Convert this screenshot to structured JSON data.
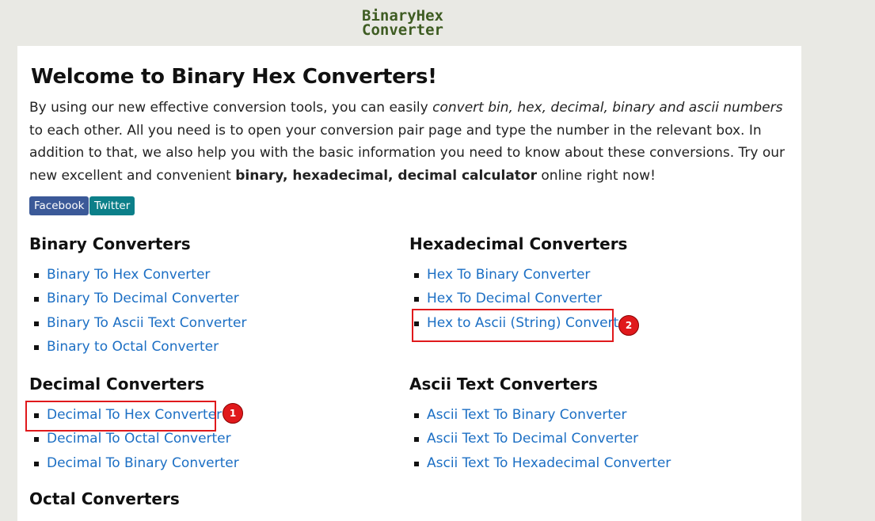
{
  "header": {
    "logo_line1": "BinaryHex",
    "logo_line2": "Converter"
  },
  "main": {
    "title": "Welcome to Binary Hex Converters!",
    "intro": {
      "part1": "By using our new effective conversion tools, you can easily ",
      "italic": "convert bin, hex, decimal, binary and ascii numbers",
      "part2": " to each other. All you need is to open your conversion pair page and type the number in the relevant box. In addition to that, we also help you with the basic information you need to know about these conversions. Try our new excellent and convenient ",
      "bold": "binary, hexadecimal, decimal calculator",
      "part3": " online right now!"
    },
    "share": {
      "facebook": "Facebook",
      "twitter": "Twitter"
    },
    "sections": {
      "binary": {
        "title": "Binary Converters",
        "links": [
          "Binary To Hex Converter",
          "Binary To Decimal Converter",
          "Binary To Ascii Text Converter",
          "Binary to Octal Converter"
        ]
      },
      "hex": {
        "title": "Hexadecimal Converters",
        "links": [
          "Hex To Binary Converter",
          "Hex To Decimal Converter",
          "Hex to Ascii (String) Converter"
        ]
      },
      "decimal": {
        "title": "Decimal Converters",
        "links": [
          "Decimal To Hex Converter",
          "Decimal To Octal Converter",
          "Decimal To Binary Converter"
        ]
      },
      "ascii": {
        "title": "Ascii Text Converters",
        "links": [
          "Ascii Text To Binary Converter",
          "Ascii Text To Decimal Converter",
          "Ascii Text To Hexadecimal Converter"
        ]
      }
    },
    "partial_heading": "Octal Converters"
  },
  "annotations": {
    "marker1": "1",
    "marker2": "2",
    "color": "#e0191c"
  }
}
